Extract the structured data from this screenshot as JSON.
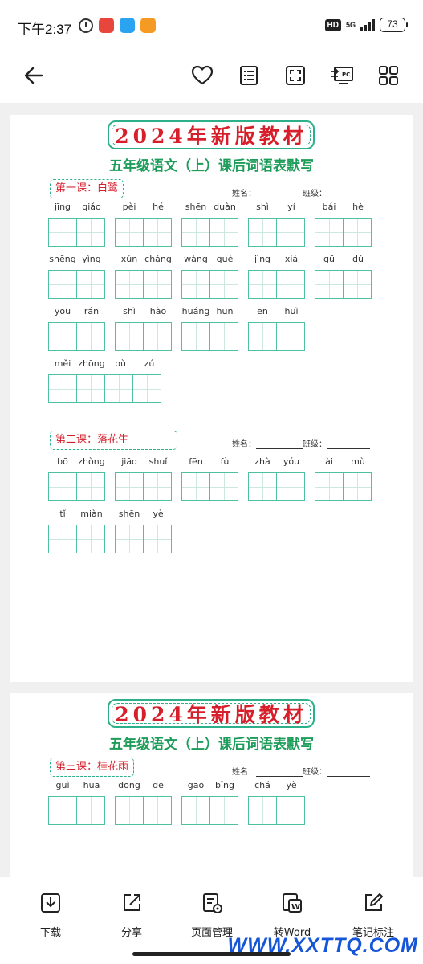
{
  "status": {
    "time": "下午2:37",
    "hd": "HD",
    "network": "5G",
    "battery": "73"
  },
  "toolbar": {
    "icons": [
      "back-arrow-icon",
      "heart-icon",
      "list-icon",
      "fullscreen-icon",
      "pc-mode-icon",
      "grid-icon"
    ]
  },
  "page1": {
    "banner": "2024年新版教材",
    "subtitle": "五年级语文（上）课后词语表默写",
    "lessons": [
      {
        "title": "第一课：白鹭",
        "name_label": "姓名：",
        "class_label": "班级：",
        "rows": [
          [
            [
              "jīng",
              "qiǎo"
            ],
            [
              "pèi",
              "hé"
            ],
            [
              "shēn",
              "duàn"
            ],
            [
              "shì",
              "yí"
            ],
            [
              "bái",
              "hè"
            ]
          ],
          [
            [
              "shēng",
              "yìng"
            ],
            [
              "xún",
              "cháng"
            ],
            [
              "wàng",
              "què"
            ],
            [
              "jìng",
              "xiá"
            ],
            [
              "gū",
              "dú"
            ]
          ],
          [
            [
              "yōu",
              "rán"
            ],
            [
              "shì",
              "hào"
            ],
            [
              "huáng",
              "hūn"
            ],
            [
              "ēn",
              "huì"
            ]
          ],
          [
            [
              "měi",
              "zhōng",
              "bù",
              "zú"
            ]
          ]
        ]
      },
      {
        "title": "第二课：落花生",
        "name_label": "姓名：",
        "class_label": "班级：",
        "rows": [
          [
            [
              "bō",
              "zhòng"
            ],
            [
              "jiāo",
              "shuǐ"
            ],
            [
              "fēn",
              "fù"
            ],
            [
              "zhà",
              "yóu"
            ],
            [
              "ài",
              "mù"
            ]
          ],
          [
            [
              "tǐ",
              "miàn"
            ],
            [
              "shēn",
              "yè"
            ]
          ]
        ]
      }
    ]
  },
  "page2": {
    "banner": "2024年新版教材",
    "subtitle": "五年级语文（上）课后词语表默写",
    "lessons": [
      {
        "title": "第三课：桂花雨",
        "name_label": "姓名：",
        "class_label": "班级：",
        "rows": [
          [
            [
              "guì",
              "huā"
            ],
            [
              "dōng",
              "de"
            ],
            [
              "gāo",
              "bǐng"
            ],
            [
              "chá",
              "yè"
            ]
          ]
        ]
      }
    ]
  },
  "bottom_bar": {
    "items": [
      {
        "label": "下载",
        "icon": "download-icon"
      },
      {
        "label": "分享",
        "icon": "share-icon"
      },
      {
        "label": "页面管理",
        "icon": "page-manage-icon"
      },
      {
        "label": "转Word",
        "icon": "word-convert-icon"
      },
      {
        "label": "笔记标注",
        "icon": "note-edit-icon"
      }
    ]
  },
  "watermark": "WWW.XXTTQ.COM"
}
